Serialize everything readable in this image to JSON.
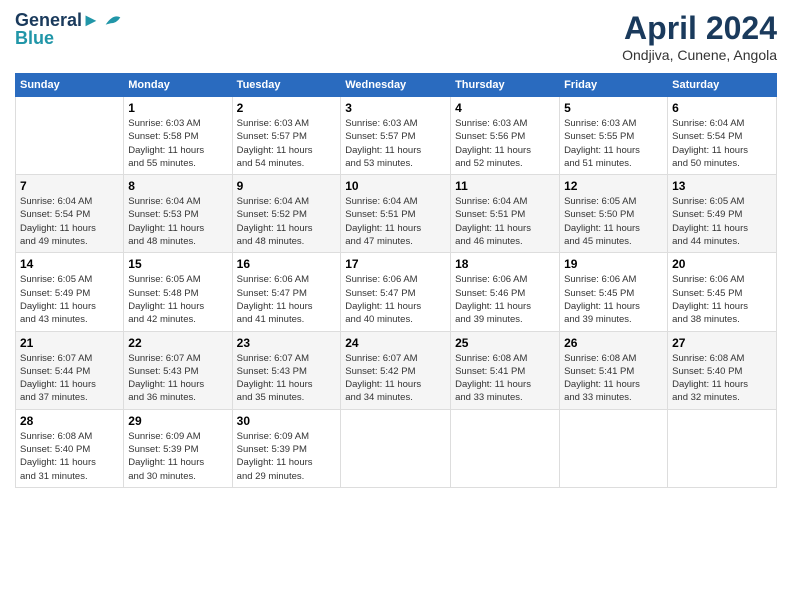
{
  "header": {
    "logo_line1": "General",
    "logo_line2": "Blue",
    "month": "April 2024",
    "location": "Ondjiva, Cunene, Angola"
  },
  "days_of_week": [
    "Sunday",
    "Monday",
    "Tuesday",
    "Wednesday",
    "Thursday",
    "Friday",
    "Saturday"
  ],
  "weeks": [
    [
      {
        "day": "",
        "info": ""
      },
      {
        "day": "1",
        "info": "Sunrise: 6:03 AM\nSunset: 5:58 PM\nDaylight: 11 hours\nand 55 minutes."
      },
      {
        "day": "2",
        "info": "Sunrise: 6:03 AM\nSunset: 5:57 PM\nDaylight: 11 hours\nand 54 minutes."
      },
      {
        "day": "3",
        "info": "Sunrise: 6:03 AM\nSunset: 5:57 PM\nDaylight: 11 hours\nand 53 minutes."
      },
      {
        "day": "4",
        "info": "Sunrise: 6:03 AM\nSunset: 5:56 PM\nDaylight: 11 hours\nand 52 minutes."
      },
      {
        "day": "5",
        "info": "Sunrise: 6:03 AM\nSunset: 5:55 PM\nDaylight: 11 hours\nand 51 minutes."
      },
      {
        "day": "6",
        "info": "Sunrise: 6:04 AM\nSunset: 5:54 PM\nDaylight: 11 hours\nand 50 minutes."
      }
    ],
    [
      {
        "day": "7",
        "info": ""
      },
      {
        "day": "8",
        "info": "Sunrise: 6:04 AM\nSunset: 5:53 PM\nDaylight: 11 hours\nand 48 minutes."
      },
      {
        "day": "9",
        "info": "Sunrise: 6:04 AM\nSunset: 5:52 PM\nDaylight: 11 hours\nand 48 minutes."
      },
      {
        "day": "10",
        "info": "Sunrise: 6:04 AM\nSunset: 5:51 PM\nDaylight: 11 hours\nand 47 minutes."
      },
      {
        "day": "11",
        "info": "Sunrise: 6:04 AM\nSunset: 5:51 PM\nDaylight: 11 hours\nand 46 minutes."
      },
      {
        "day": "12",
        "info": "Sunrise: 6:05 AM\nSunset: 5:50 PM\nDaylight: 11 hours\nand 45 minutes."
      },
      {
        "day": "13",
        "info": "Sunrise: 6:05 AM\nSunset: 5:49 PM\nDaylight: 11 hours\nand 44 minutes."
      }
    ],
    [
      {
        "day": "14",
        "info": ""
      },
      {
        "day": "15",
        "info": "Sunrise: 6:05 AM\nSunset: 5:48 PM\nDaylight: 11 hours\nand 42 minutes."
      },
      {
        "day": "16",
        "info": "Sunrise: 6:06 AM\nSunset: 5:47 PM\nDaylight: 11 hours\nand 41 minutes."
      },
      {
        "day": "17",
        "info": "Sunrise: 6:06 AM\nSunset: 5:47 PM\nDaylight: 11 hours\nand 40 minutes."
      },
      {
        "day": "18",
        "info": "Sunrise: 6:06 AM\nSunset: 5:46 PM\nDaylight: 11 hours\nand 39 minutes."
      },
      {
        "day": "19",
        "info": "Sunrise: 6:06 AM\nSunset: 5:45 PM\nDaylight: 11 hours\nand 39 minutes."
      },
      {
        "day": "20",
        "info": "Sunrise: 6:06 AM\nSunset: 5:45 PM\nDaylight: 11 hours\nand 38 minutes."
      }
    ],
    [
      {
        "day": "21",
        "info": ""
      },
      {
        "day": "22",
        "info": "Sunrise: 6:07 AM\nSunset: 5:43 PM\nDaylight: 11 hours\nand 36 minutes."
      },
      {
        "day": "23",
        "info": "Sunrise: 6:07 AM\nSunset: 5:43 PM\nDaylight: 11 hours\nand 35 minutes."
      },
      {
        "day": "24",
        "info": "Sunrise: 6:07 AM\nSunset: 5:42 PM\nDaylight: 11 hours\nand 34 minutes."
      },
      {
        "day": "25",
        "info": "Sunrise: 6:08 AM\nSunset: 5:41 PM\nDaylight: 11 hours\nand 33 minutes."
      },
      {
        "day": "26",
        "info": "Sunrise: 6:08 AM\nSunset: 5:41 PM\nDaylight: 11 hours\nand 33 minutes."
      },
      {
        "day": "27",
        "info": "Sunrise: 6:08 AM\nSunset: 5:40 PM\nDaylight: 11 hours\nand 32 minutes."
      }
    ],
    [
      {
        "day": "28",
        "info": "Sunrise: 6:08 AM\nSunset: 5:40 PM\nDaylight: 11 hours\nand 31 minutes."
      },
      {
        "day": "29",
        "info": "Sunrise: 6:09 AM\nSunset: 5:39 PM\nDaylight: 11 hours\nand 30 minutes."
      },
      {
        "day": "30",
        "info": "Sunrise: 6:09 AM\nSunset: 5:39 PM\nDaylight: 11 hours\nand 29 minutes."
      },
      {
        "day": "",
        "info": ""
      },
      {
        "day": "",
        "info": ""
      },
      {
        "day": "",
        "info": ""
      },
      {
        "day": "",
        "info": ""
      }
    ]
  ],
  "week1_sun": "Sunrise: 6:04 AM\nSunset: 5:54 PM\nDaylight: 11 hours\nand 49 minutes.",
  "week3_sun": "Sunrise: 6:05 AM\nSunset: 5:49 PM\nDaylight: 11 hours\nand 43 minutes.",
  "week4_sun": "Sunrise: 6:07 AM\nSunset: 5:44 PM\nDaylight: 11 hours\nand 37 minutes."
}
